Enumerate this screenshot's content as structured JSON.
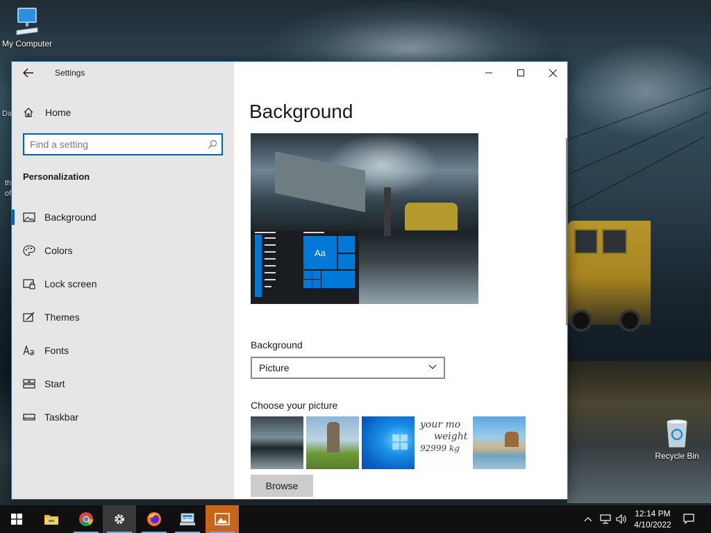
{
  "desktop": {
    "icons": [
      {
        "label": "My Computer"
      },
      {
        "label": "Recycle Bin"
      }
    ],
    "left_fragments": [
      "Da",
      "th",
      "of"
    ]
  },
  "window": {
    "title": "Settings",
    "nav": {
      "home_label": "Home",
      "search_placeholder": "Find a setting",
      "section": "Personalization",
      "items": [
        {
          "label": "Background",
          "icon": "picture-icon",
          "active": true
        },
        {
          "label": "Colors",
          "icon": "palette-icon"
        },
        {
          "label": "Lock screen",
          "icon": "lock-screen-icon"
        },
        {
          "label": "Themes",
          "icon": "themes-icon"
        },
        {
          "label": "Fonts",
          "icon": "fonts-icon"
        },
        {
          "label": "Start",
          "icon": "start-icon"
        },
        {
          "label": "Taskbar",
          "icon": "taskbar-icon"
        }
      ]
    },
    "content": {
      "title": "Background",
      "preview_tile_text": "Aa",
      "background_label": "Background",
      "background_value": "Picture",
      "choose_label": "Choose your picture",
      "thumb4_text": [
        "your mo",
        "weight",
        "92999 kg"
      ],
      "browse_label": "Browse"
    }
  },
  "taskbar": {
    "apps": [
      "start-icon",
      "file-explorer-icon",
      "chrome-icon",
      "settings-icon",
      "firefox-icon",
      "control-panel-icon",
      "photos-icon"
    ],
    "time": "12:14 PM",
    "date": "4/10/2022"
  },
  "colors": {
    "accent": "#0063b1",
    "tile_blue": "#0078d7",
    "photos_orange": "#c8651b"
  }
}
